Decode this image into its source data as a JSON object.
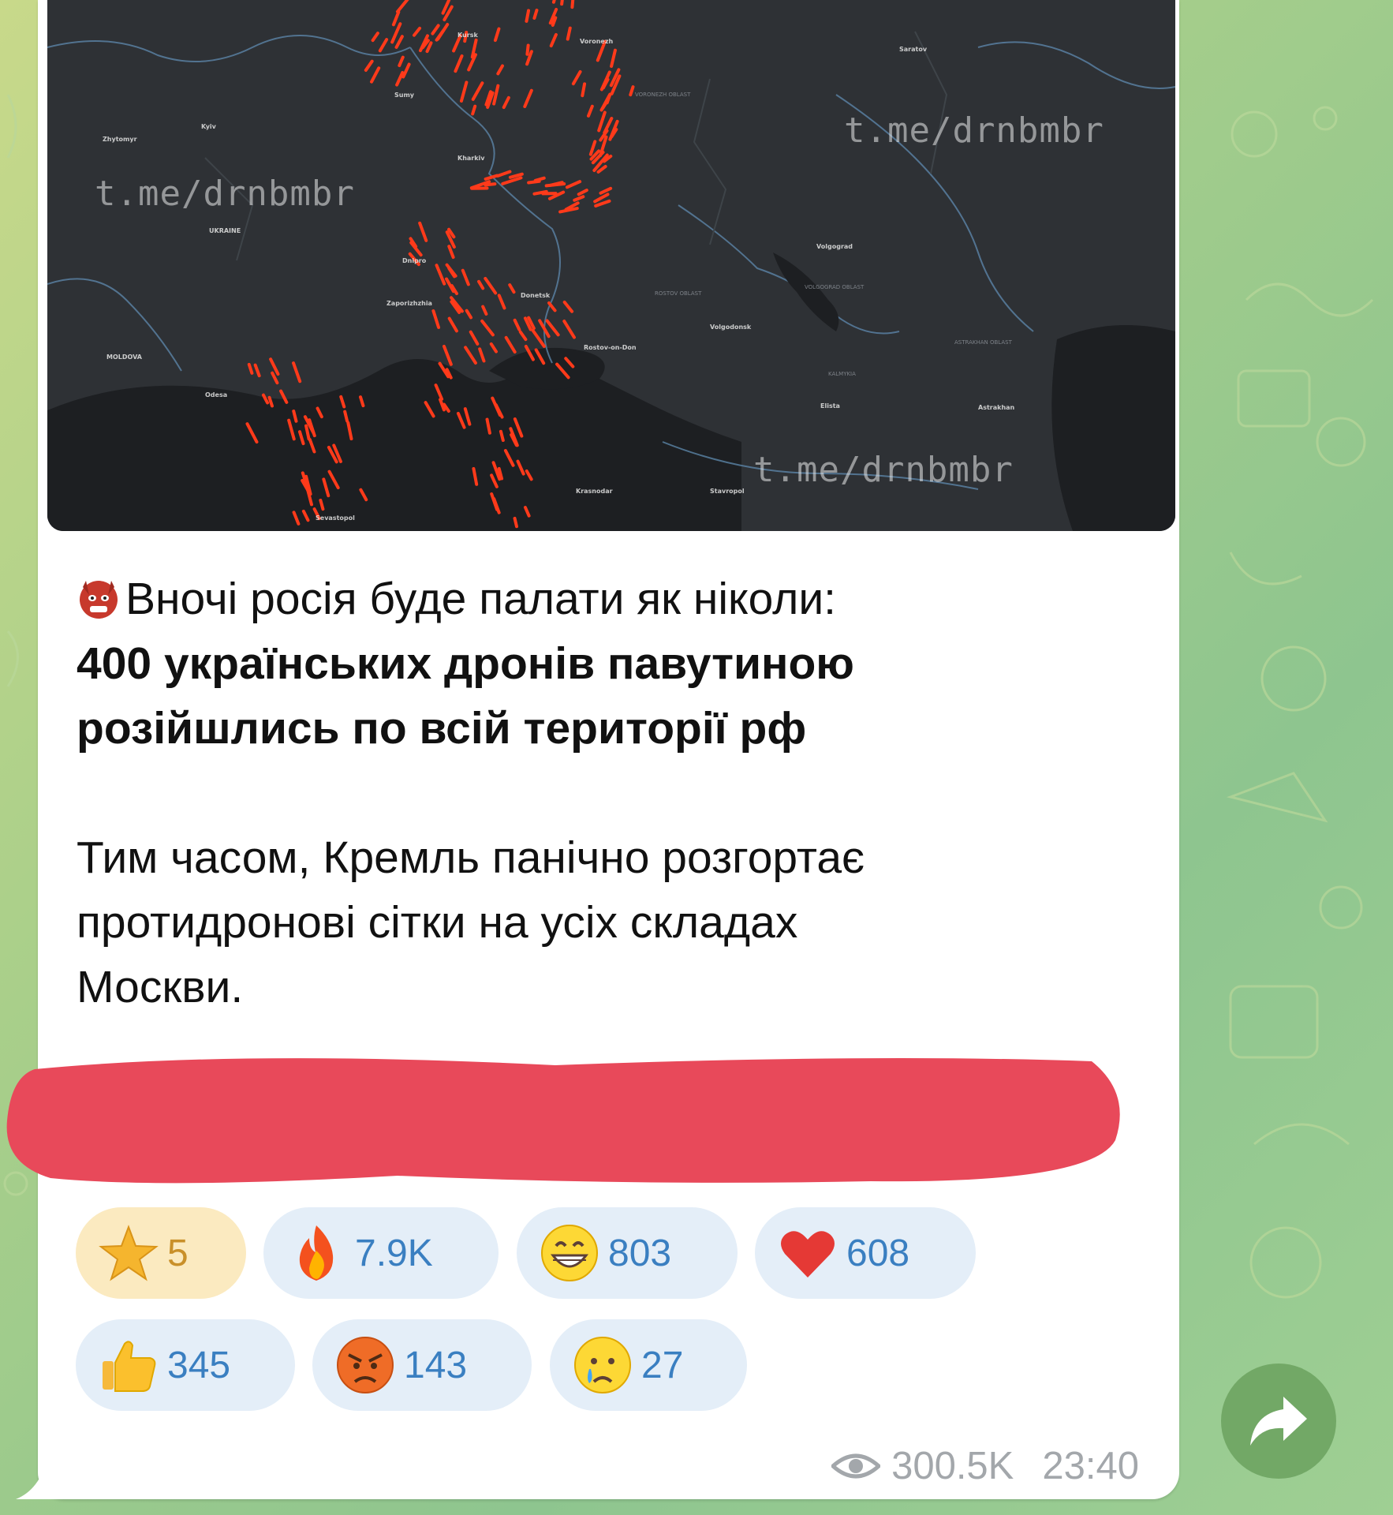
{
  "map": {
    "watermark": "t.me/drnbmbr",
    "labels": [
      "Kursk",
      "Voronezh",
      "Saratov",
      "Sumy",
      "Zhytomyr",
      "Kyiv",
      "Kharkiv",
      "UKRAINE",
      "Dnipro",
      "Volgograd",
      "Donetsk",
      "Zaporizhzhia",
      "Volgodonsk",
      "Rostov-on-Don",
      "MOLDOVA",
      "Odesa",
      "Elista",
      "Astrakhan",
      "Krasnodar",
      "Stavropol",
      "Sevastopol",
      "ROSTOV OBLAST",
      "VOLGOGRAD OBLAST",
      "ASTRAKHAN OBLAST",
      "KALMYKIA",
      "VORONEZH OBLAST"
    ]
  },
  "message": {
    "line1": "Вночі росія буде палати як ніколи:",
    "bold_line1": "400 українських дронів павутиною",
    "bold_line2": "розійшлись по всій території рф",
    "para2_line1": "Тим часом, Кремль панічно розгортає",
    "para2_line2": "протидронові сітки на усіх складах",
    "para2_line3": "Москви."
  },
  "reactions": {
    "star": {
      "icon": "star-icon",
      "count": "5"
    },
    "fire": {
      "icon": "fire-icon",
      "count": "7.9K"
    },
    "grin": {
      "icon": "grinning-face-icon",
      "count": "803"
    },
    "heart": {
      "icon": "red-heart-icon",
      "count": "608"
    },
    "thumbs": {
      "icon": "thumbs-up-icon",
      "count": "345"
    },
    "angry": {
      "icon": "angry-face-icon",
      "count": "143"
    },
    "cry": {
      "icon": "crying-face-icon",
      "count": "27"
    }
  },
  "meta": {
    "views": "300.5K",
    "time": "23:40"
  },
  "colors": {
    "reaction_bg": "#e4eef8",
    "reaction_text": "#3a7fc1",
    "redaction": "#e8495a",
    "share_button": "#72a866",
    "drone_marks": "#ff3a1a"
  }
}
